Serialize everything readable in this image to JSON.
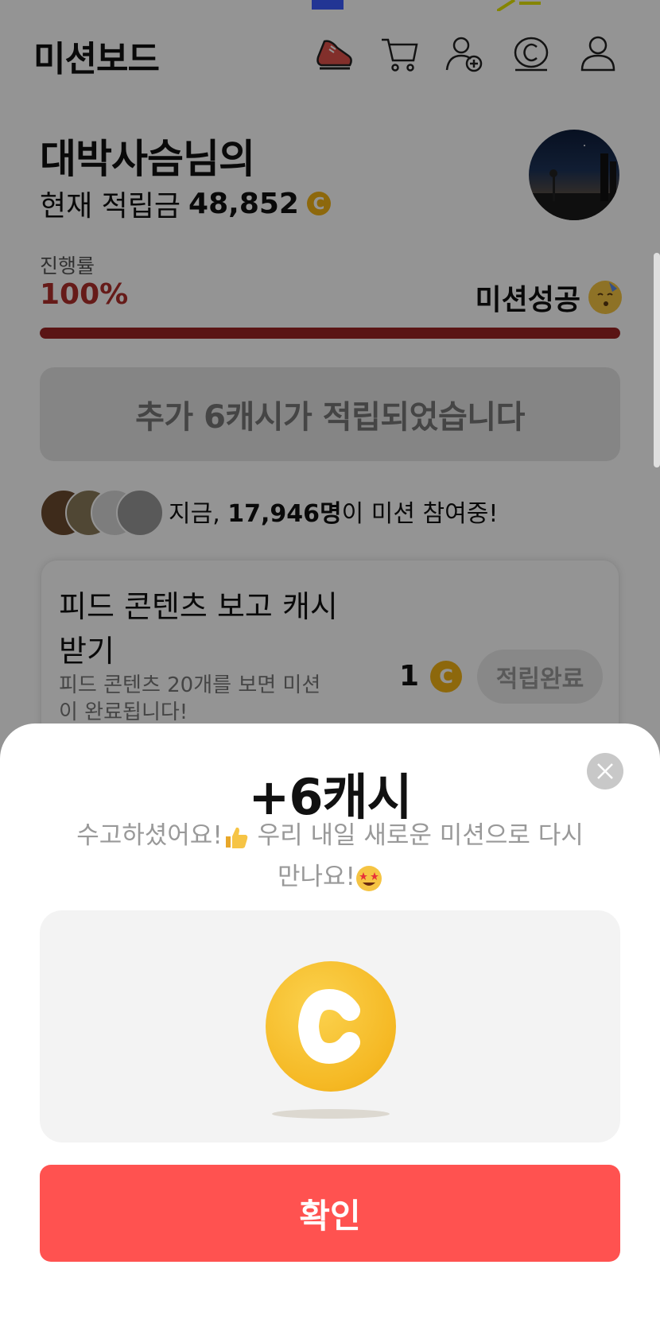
{
  "header": {
    "title": "미션보드",
    "icons": [
      "sneaker-icon",
      "cart-icon",
      "add-friend-icon",
      "coin-badge-icon",
      "profile-icon"
    ]
  },
  "profile": {
    "name": "대박사슴님의",
    "balance_label": "현재 적립금",
    "balance_value": "48,852",
    "coin_symbol": "C"
  },
  "progress": {
    "label": "진행률",
    "value_text": "100%",
    "value": 1.0,
    "status": "미션성공"
  },
  "banner": {
    "text": "추가 6캐시가 적립되었습니다"
  },
  "participants": {
    "prefix": "지금, ",
    "count": "17,946명",
    "suffix": "이 미션 참여중!"
  },
  "mission": {
    "title": "피드 콘텐츠 보고 캐시 받기",
    "description": "피드 콘텐츠 20개를 보면 미션이 완료됩니다!",
    "amount": "1",
    "coin_symbol": "C",
    "button": "적립완료"
  },
  "modal": {
    "title": "+6캐시",
    "message_line1": "수고하셨어요!",
    "message_line1b": " 우리 내일 새로운 미션으로 다시",
    "message_line2": "만나요!",
    "coin_symbol": "C",
    "confirm": "확인"
  },
  "colors": {
    "accent_red": "#ff5250",
    "progress_red": "#9b2424",
    "coin_gold": "#f3b416"
  }
}
